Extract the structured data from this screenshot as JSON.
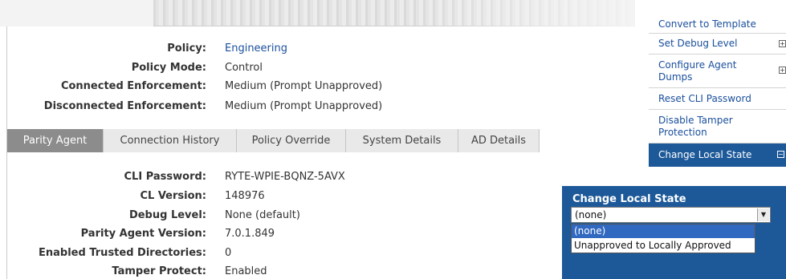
{
  "policy_info": [
    {
      "label": "Policy:",
      "value": "Engineering"
    },
    {
      "label": "Policy Mode:",
      "value": "Control"
    },
    {
      "label": "Connected Enforcement:",
      "value": "Medium (Prompt Unapproved)"
    },
    {
      "label": "Disconnected Enforcement:",
      "value": "Medium (Prompt Unapproved)"
    }
  ],
  "tabs": [
    {
      "label": "Parity Agent",
      "active": true
    },
    {
      "label": "Connection History",
      "active": false
    },
    {
      "label": "Policy Override",
      "active": false
    },
    {
      "label": "System Details",
      "active": false
    },
    {
      "label": "AD Details",
      "active": false
    }
  ],
  "agent_details": [
    {
      "label": "CLI Password:",
      "value": "RYTE-WPIE-BQNZ-5AVX"
    },
    {
      "label": "CL Version:",
      "value": "148976"
    },
    {
      "label": "Debug Level:",
      "value": "None (default)"
    },
    {
      "label": "Parity Agent Version:",
      "value": "7.0.1.849"
    },
    {
      "label": "Enabled Trusted Directories:",
      "value": "0"
    },
    {
      "label": "Tamper Protect:",
      "value": "Enabled"
    }
  ],
  "sidebar": {
    "items": [
      {
        "line1": "Convert to Template",
        "line2": "",
        "expander": ""
      },
      {
        "line1": "Set Debug Level",
        "line2": "",
        "expander": "+"
      },
      {
        "line1": "Configure Agent",
        "line2": "Dumps",
        "expander": "+"
      },
      {
        "line1": "Reset CLI Password",
        "line2": "",
        "expander": ""
      },
      {
        "line1": "Disable Tamper",
        "line2": "Protection",
        "expander": ""
      },
      {
        "line1": "Change Local State",
        "line2": "",
        "expander": "−"
      }
    ]
  },
  "change_local_state": {
    "title": "Change Local State",
    "selected": "(none)",
    "options": [
      "(none)",
      "Unapproved to Locally Approved"
    ],
    "highlighted_index": 0
  },
  "colors": {
    "link": "#1a4f9c",
    "panel_blue": "#1d5999",
    "active_tab": "#8c8c8c",
    "option_highlight": "#3168c0"
  }
}
